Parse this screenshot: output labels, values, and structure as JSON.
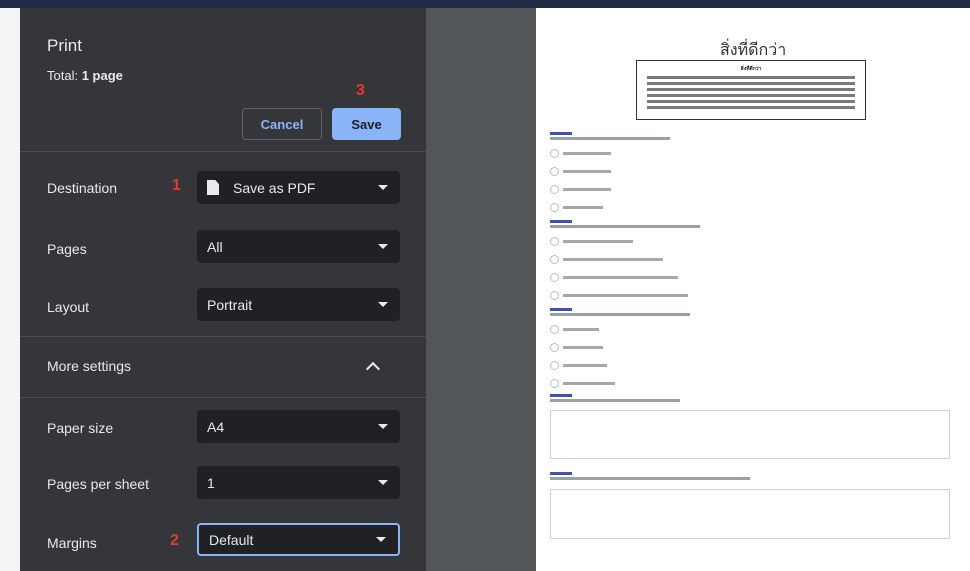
{
  "panel": {
    "title": "Print",
    "total_label": "Total: ",
    "total_value": "1 page",
    "cancel_label": "Cancel",
    "save_label": "Save",
    "destination_label": "Destination",
    "destination_value": "Save as PDF",
    "pages_label": "Pages",
    "pages_value": "All",
    "layout_label": "Layout",
    "layout_value": "Portrait",
    "more_settings_label": "More settings",
    "paper_size_label": "Paper size",
    "paper_size_value": "A4",
    "pages_per_sheet_label": "Pages per sheet",
    "pages_per_sheet_value": "1",
    "margins_label": "Margins",
    "margins_value": "Default"
  },
  "annotations": {
    "n1": "1",
    "n2": "2",
    "n3": "3"
  },
  "preview": {
    "doc_title": "สิ่งที่ดีกว่า",
    "box_title": "สิ่งที่ดีกว่า"
  },
  "colors": {
    "panel": "#35363a",
    "select": "#202124",
    "accent": "#8ab4f8",
    "annotation": "#e53935"
  }
}
